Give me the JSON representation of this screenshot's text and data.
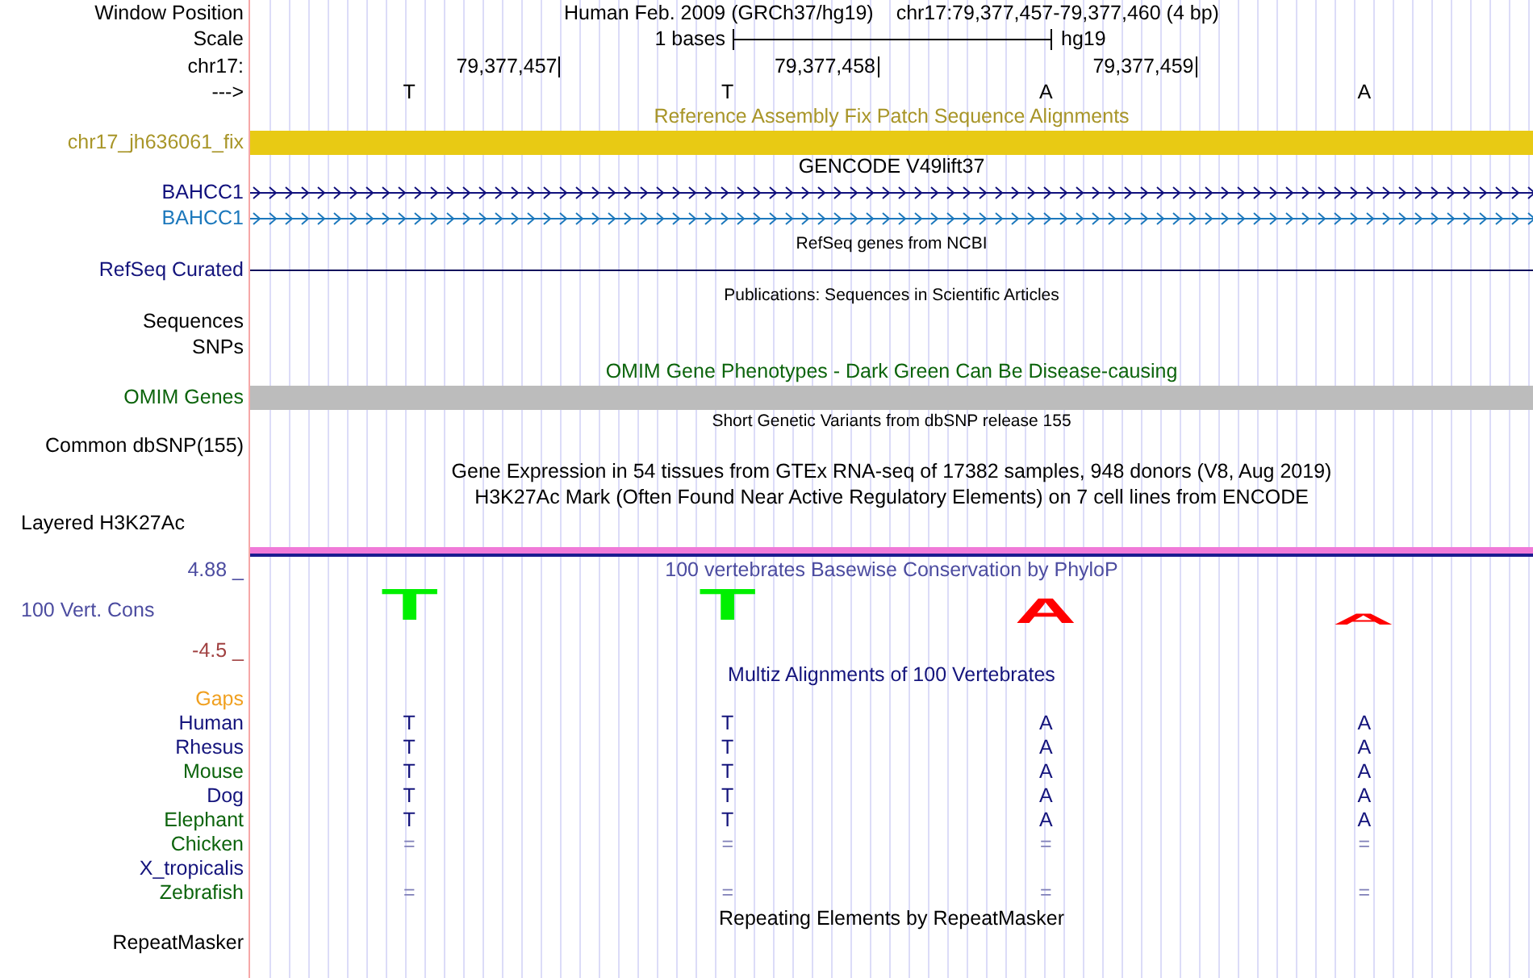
{
  "ruler": {
    "window_label": "Window Position",
    "assembly": "Human Feb. 2009 (GRCh37/hg19)",
    "position": "chr17:79,377,457-79,377,460 (4 bp)",
    "scale_label": "Scale",
    "scale_text": "1 bases",
    "scale_db": "hg19",
    "chrom_label": "chr17:",
    "ticks": [
      "79,377,457",
      "79,377,458",
      "79,377,459"
    ],
    "strand": "--->",
    "bases": [
      "T",
      "T",
      "A",
      "A"
    ]
  },
  "fix_patch": {
    "title": "Reference Assembly Fix Patch Sequence Alignments",
    "label": "chr17_jh636061_fix"
  },
  "gencode": {
    "title": "GENCODE V49lift37",
    "genes": [
      {
        "label": "BAHCC1",
        "color": "#10107c"
      },
      {
        "label": "BAHCC1",
        "color": "#1c78bc"
      }
    ]
  },
  "refseq": {
    "title": "RefSeq genes from NCBI",
    "label": "RefSeq Curated"
  },
  "publications": {
    "title": "Publications: Sequences in Scientific Articles",
    "labels": [
      "Sequences",
      "SNPs"
    ]
  },
  "omim": {
    "title": "OMIM Gene Phenotypes - Dark Green Can Be Disease-causing",
    "label": "OMIM Genes"
  },
  "dbsnp": {
    "title": "Short Genetic Variants from dbSNP release 155",
    "label": "Common dbSNP(155)"
  },
  "gtex": {
    "title": "Gene Expression in 54 tissues from GTEx RNA-seq of 17382 samples, 948 donors (V8, Aug 2019)"
  },
  "h3k27ac": {
    "title": "H3K27Ac Mark (Often Found Near Active Regulatory Elements) on 7 cell lines from ENCODE",
    "label": "Layered H3K27Ac"
  },
  "phylop": {
    "title": "100 vertebrates Basewise Conservation by PhyloP",
    "label": "100 Vert. Cons",
    "max": "4.88 _",
    "min": "-4.5 _",
    "logo": [
      {
        "letter": "T",
        "color": "#00f000",
        "kind": "tall"
      },
      {
        "letter": "T",
        "color": "#00f000",
        "kind": "tall"
      },
      {
        "letter": "A",
        "color": "#ff0000",
        "kind": "medium"
      },
      {
        "letter": "A",
        "color": "#ff0000",
        "kind": "short"
      }
    ]
  },
  "multiz": {
    "title": "Multiz Alignments of 100 Vertebrates",
    "gaps_label": "Gaps",
    "species": [
      {
        "name": "Human",
        "color": "#14147c",
        "kind": "bases",
        "bases": [
          "T",
          "T",
          "A",
          "A"
        ]
      },
      {
        "name": "Rhesus",
        "color": "#14147c",
        "kind": "bases",
        "bases": [
          "T",
          "T",
          "A",
          "A"
        ]
      },
      {
        "name": "Mouse",
        "color": "#0c640c",
        "kind": "bases",
        "bases": [
          "T",
          "T",
          "A",
          "A"
        ]
      },
      {
        "name": "Dog",
        "color": "#14147c",
        "kind": "bases",
        "bases": [
          "T",
          "T",
          "A",
          "A"
        ]
      },
      {
        "name": "Elephant",
        "color": "#0c640c",
        "kind": "bases",
        "bases": [
          "T",
          "T",
          "A",
          "A"
        ]
      },
      {
        "name": "Chicken",
        "color": "#0c640c",
        "kind": "double_gap",
        "bases": [
          "=",
          "=",
          "=",
          "="
        ]
      },
      {
        "name": "X_tropicalis",
        "color": "#14147c"
      },
      {
        "name": "Zebrafish",
        "color": "#0c640c",
        "kind": "double_gap",
        "bases": [
          "=",
          "=",
          "=",
          "="
        ]
      }
    ]
  },
  "repeatmasker": {
    "title": "Repeating Elements by RepeatMasker",
    "label": "RepeatMasker"
  }
}
